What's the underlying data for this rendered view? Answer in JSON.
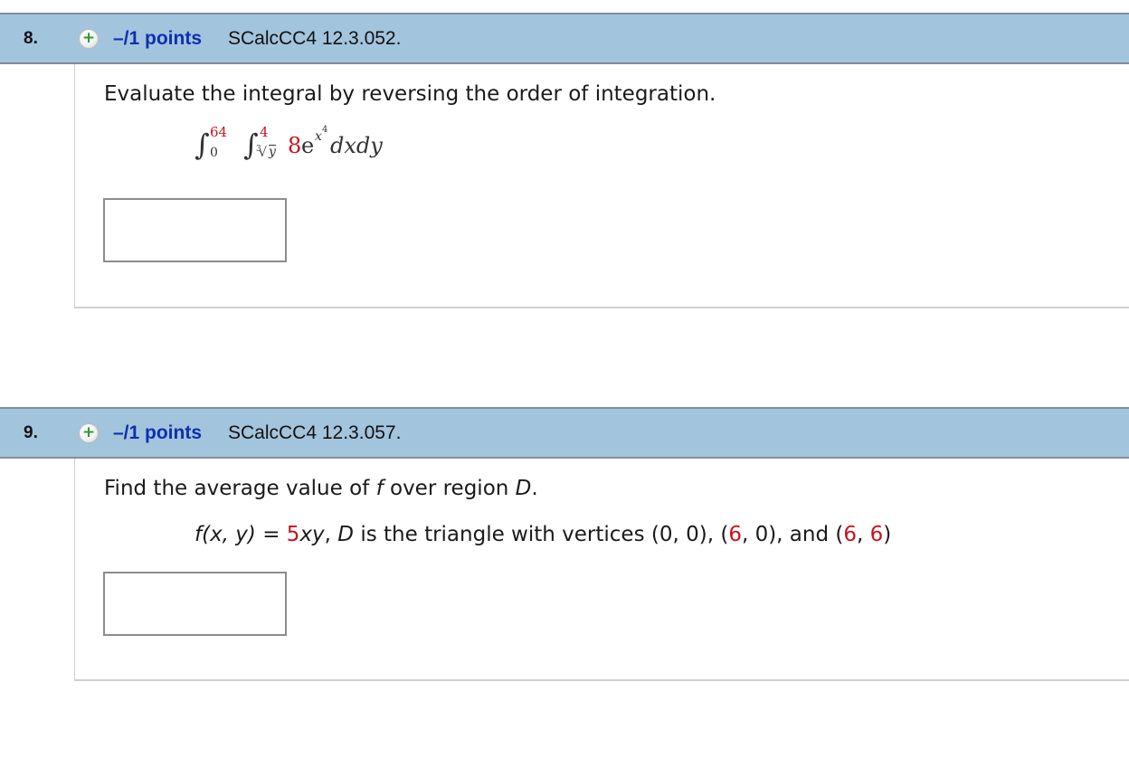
{
  "questions": [
    {
      "number": "8.",
      "points": "–/1 points",
      "id": "SCalcCC4 12.3.052.",
      "prompt": "Evaluate the integral by reversing the order of integration.",
      "integral": {
        "outer_upper": "64",
        "outer_lower": "0",
        "inner_upper": "4",
        "inner_lower_index": "3",
        "inner_lower_radicand": "y",
        "coefficient": "8",
        "base": "e",
        "exponent_var": "x",
        "exponent_power": "4",
        "differentials": "dxdy"
      },
      "answer_value": ""
    },
    {
      "number": "9.",
      "points": "–/1 points",
      "id": "SCalcCC4 12.3.057.",
      "prompt": {
        "pre": "Find the average value of ",
        "f": "f",
        "mid": " over region ",
        "D": "D",
        "post": "."
      },
      "function_line": {
        "lhs": "f(x, y)",
        "eq": " = ",
        "coef": "5",
        "rhs_var": "xy",
        "sep": ", ",
        "D": "D",
        "desc": " is the triangle with vertices (0, 0), (",
        "v2x": "6",
        "v2rest": ", 0), and (",
        "v3x": "6",
        "v3sep": ", ",
        "v3y": "6",
        "close": ")"
      },
      "answer_value": ""
    }
  ],
  "colors": {
    "header_bg": "#a3c4dd",
    "points_blue": "#0f2fb0",
    "value_red": "#c8141c",
    "plus_green": "#2e9a2e"
  },
  "icons": {
    "expand": "plus-circle-icon"
  }
}
